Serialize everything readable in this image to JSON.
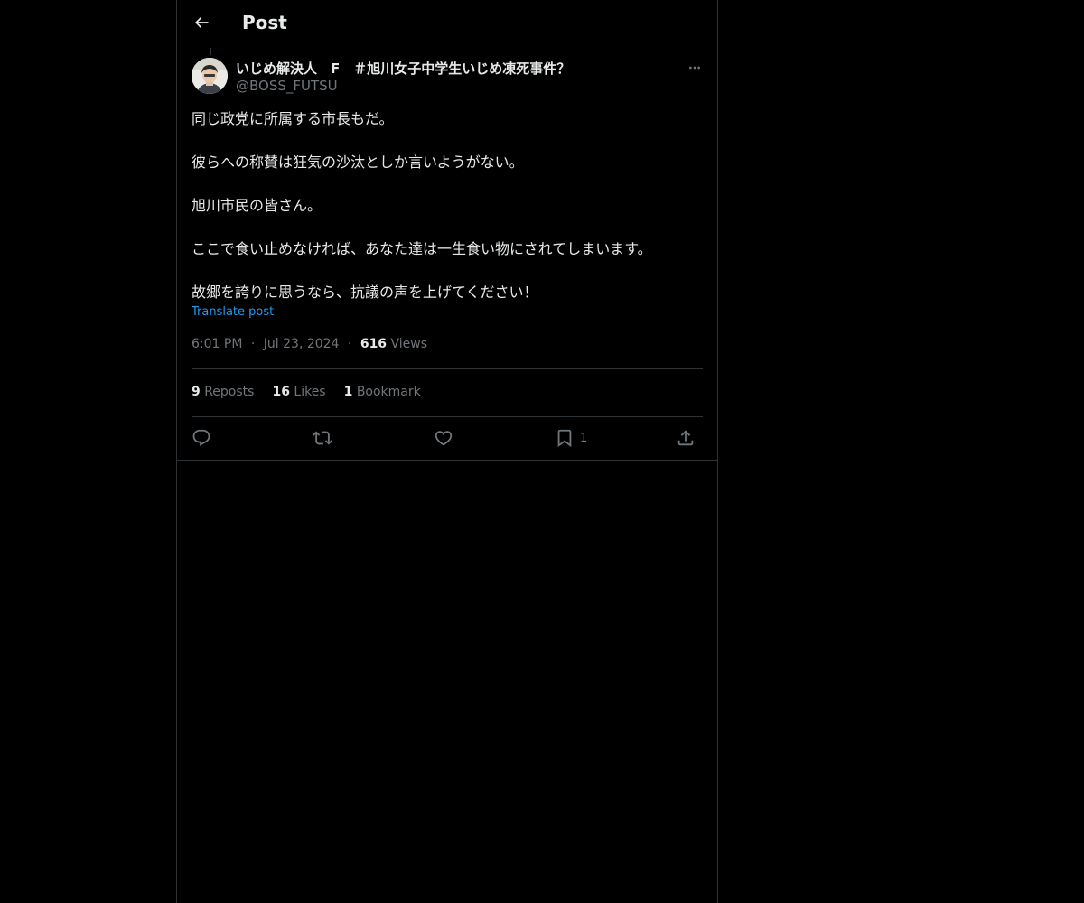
{
  "header": {
    "title": "Post",
    "back_icon": "arrow-left-icon"
  },
  "post": {
    "author": {
      "display_name": "いじめ解決人　F　＃旭川女子中学生いじめ凍死事件？",
      "handle": "@BOSS_FUTSU"
    },
    "paragraphs": [
      "同じ政党に所属する市長もだ。",
      "彼らへの称賛は狂気の沙汰としか言いようがない。",
      "旭川市民の皆さん。",
      "ここで食い止めなければ、あなた達は一生食い物にされてしまいます。",
      "故郷を誇りに思うなら、抗議の声を上げてください！"
    ],
    "translate_label": "Translate post",
    "time": "6:01 PM",
    "date": "Jul 23, 2024",
    "separator": "·",
    "views_count": "616",
    "views_label": "Views"
  },
  "stats": {
    "reposts_count": "9",
    "reposts_label": "Reposts",
    "likes_count": "16",
    "likes_label": "Likes",
    "bookmarks_count": "1",
    "bookmarks_label": "Bookmark"
  },
  "actions": {
    "reply_icon": "reply-icon",
    "repost_icon": "repost-icon",
    "like_icon": "like-icon",
    "bookmark_icon": "bookmark-icon",
    "bookmark_count": "1",
    "share_icon": "share-icon"
  },
  "colors": {
    "background": "#000000",
    "text": "#e7e9ea",
    "muted": "#71767b",
    "accent": "#1d9bf0",
    "border": "#2f3336"
  }
}
